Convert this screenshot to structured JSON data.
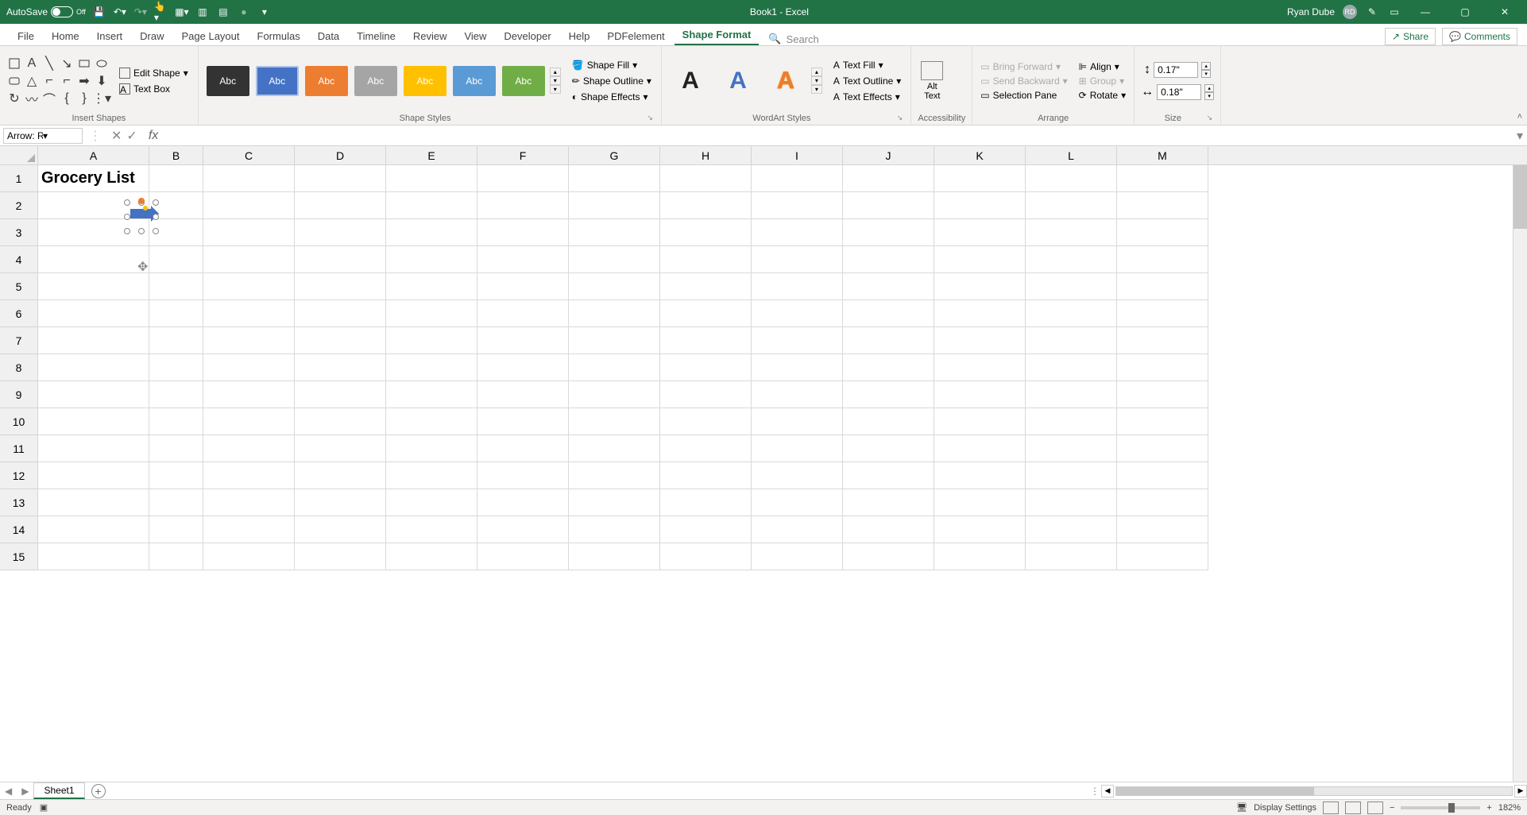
{
  "titlebar": {
    "autosave_label": "AutoSave",
    "autosave_state": "Off",
    "doc_title": "Book1 - Excel",
    "user_name": "Ryan Dube",
    "user_initials": "RD"
  },
  "tabs": {
    "file": "File",
    "home": "Home",
    "insert": "Insert",
    "draw": "Draw",
    "page_layout": "Page Layout",
    "formulas": "Formulas",
    "data": "Data",
    "timeline": "Timeline",
    "review": "Review",
    "view": "View",
    "developer": "Developer",
    "help": "Help",
    "pdfelement": "PDFelement",
    "shape_format": "Shape Format",
    "search_placeholder": "Search",
    "share": "Share",
    "comments": "Comments"
  },
  "ribbon": {
    "insert_shapes": {
      "edit_shape": "Edit Shape",
      "text_box": "Text Box",
      "group_label": "Insert Shapes"
    },
    "shape_styles": {
      "swatch_label": "Abc",
      "shape_fill": "Shape Fill",
      "shape_outline": "Shape Outline",
      "shape_effects": "Shape Effects",
      "group_label": "Shape Styles"
    },
    "wordart": {
      "text_fill": "Text Fill",
      "text_outline": "Text Outline",
      "text_effects": "Text Effects",
      "group_label": "WordArt Styles"
    },
    "accessibility": {
      "alt_text": "Alt\nText",
      "group_label": "Accessibility"
    },
    "arrange": {
      "bring_forward": "Bring Forward",
      "send_backward": "Send Backward",
      "selection_pane": "Selection Pane",
      "align": "Align",
      "group": "Group",
      "rotate": "Rotate",
      "group_label": "Arrange"
    },
    "size": {
      "height": "0.17\"",
      "width": "0.18\"",
      "group_label": "Size"
    }
  },
  "namebox": "Arrow: Rig...",
  "columns": [
    "A",
    "B",
    "C",
    "D",
    "E",
    "F",
    "G",
    "H",
    "I",
    "J",
    "K",
    "L",
    "M"
  ],
  "rows": [
    "1",
    "2",
    "3",
    "4",
    "5",
    "6",
    "7",
    "8",
    "9",
    "10",
    "11",
    "12",
    "13",
    "14",
    "15"
  ],
  "cell_A1": "Grocery List",
  "sheet_tabs": {
    "sheet1": "Sheet1"
  },
  "statusbar": {
    "ready": "Ready",
    "display_settings": "Display Settings",
    "zoom": "182%"
  }
}
